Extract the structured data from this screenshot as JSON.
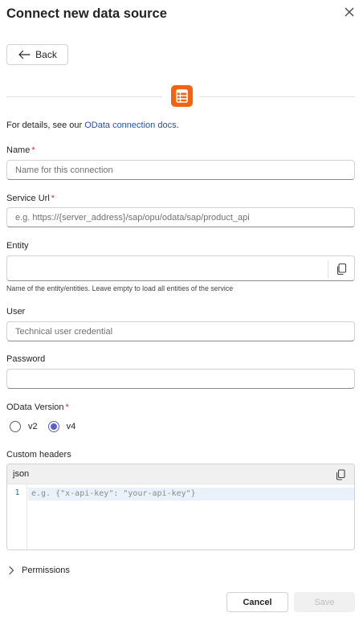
{
  "dialog": {
    "title": "Connect new data source",
    "back_label": "Back"
  },
  "details": {
    "prefix": "For details, see our ",
    "link": "OData connection docs",
    "suffix": "."
  },
  "fields": {
    "name": {
      "label": "Name",
      "required": "*",
      "placeholder": "Name for this connection"
    },
    "service_url": {
      "label": "Service Url",
      "required": "*",
      "placeholder": "e.g. https://{server_address}/sap/opu/odata/sap/product_api"
    },
    "entity": {
      "label": "Entity",
      "value": "",
      "hint": "Name of the entity/entities. Leave empty to load all entities of the service"
    },
    "user": {
      "label": "User",
      "placeholder": "Technical user credential"
    },
    "password": {
      "label": "Password",
      "value": ""
    },
    "odata_version": {
      "label": "OData Version",
      "required": "*",
      "options": [
        "v2",
        "v4"
      ],
      "selected": "v4"
    },
    "custom_headers": {
      "label": "Custom headers",
      "language": "json",
      "line_number": "1",
      "placeholder": "e.g. {\"x-api-key\": \"your-api-key\"}"
    }
  },
  "permissions": {
    "label": "Permissions"
  },
  "footer": {
    "cancel_label": "Cancel",
    "save_label": "Save"
  },
  "colors": {
    "accent": "#5b5fc7",
    "source_icon": "#f7630c",
    "required": "#c4314b",
    "link": "#2b4fa8"
  },
  "icons": {
    "close": "close-icon",
    "back": "arrow-left-icon",
    "source": "table-icon",
    "copy": "copy-icon",
    "expand": "chevron-right-icon"
  }
}
